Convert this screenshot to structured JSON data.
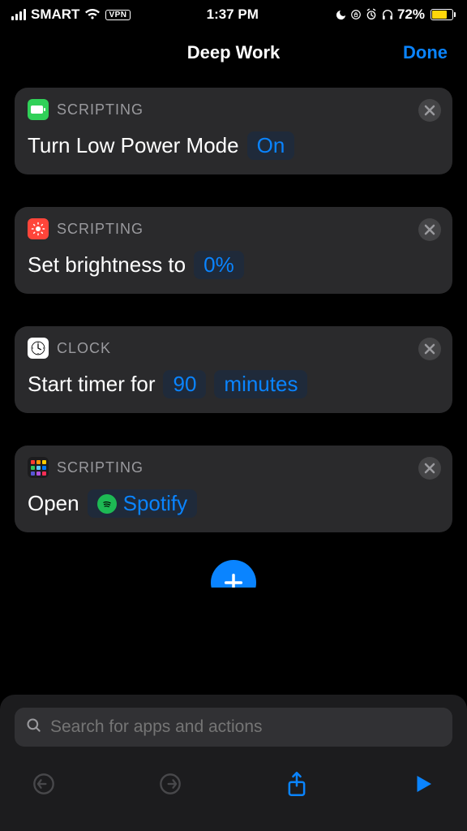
{
  "status": {
    "carrier": "SMART",
    "vpn": "VPN",
    "time": "1:37 PM",
    "battery_pct": "72%"
  },
  "nav": {
    "title": "Deep Work",
    "done": "Done"
  },
  "actions": [
    {
      "category": "SCRIPTING",
      "icon": "battery-green",
      "text": "Turn Low Power Mode",
      "pills": [
        {
          "label": "On"
        }
      ]
    },
    {
      "category": "SCRIPTING",
      "icon": "brightness-red",
      "text": "Set brightness to",
      "pills": [
        {
          "label": "0%"
        }
      ]
    },
    {
      "category": "CLOCK",
      "icon": "clock-white",
      "text": "Start timer for",
      "pills": [
        {
          "label": "90"
        },
        {
          "label": "minutes"
        }
      ]
    },
    {
      "category": "SCRIPTING",
      "icon": "grid",
      "text": "Open",
      "pills": [
        {
          "label": "Spotify",
          "app_icon": "spotify"
        }
      ]
    }
  ],
  "search": {
    "placeholder": "Search for apps and actions"
  }
}
